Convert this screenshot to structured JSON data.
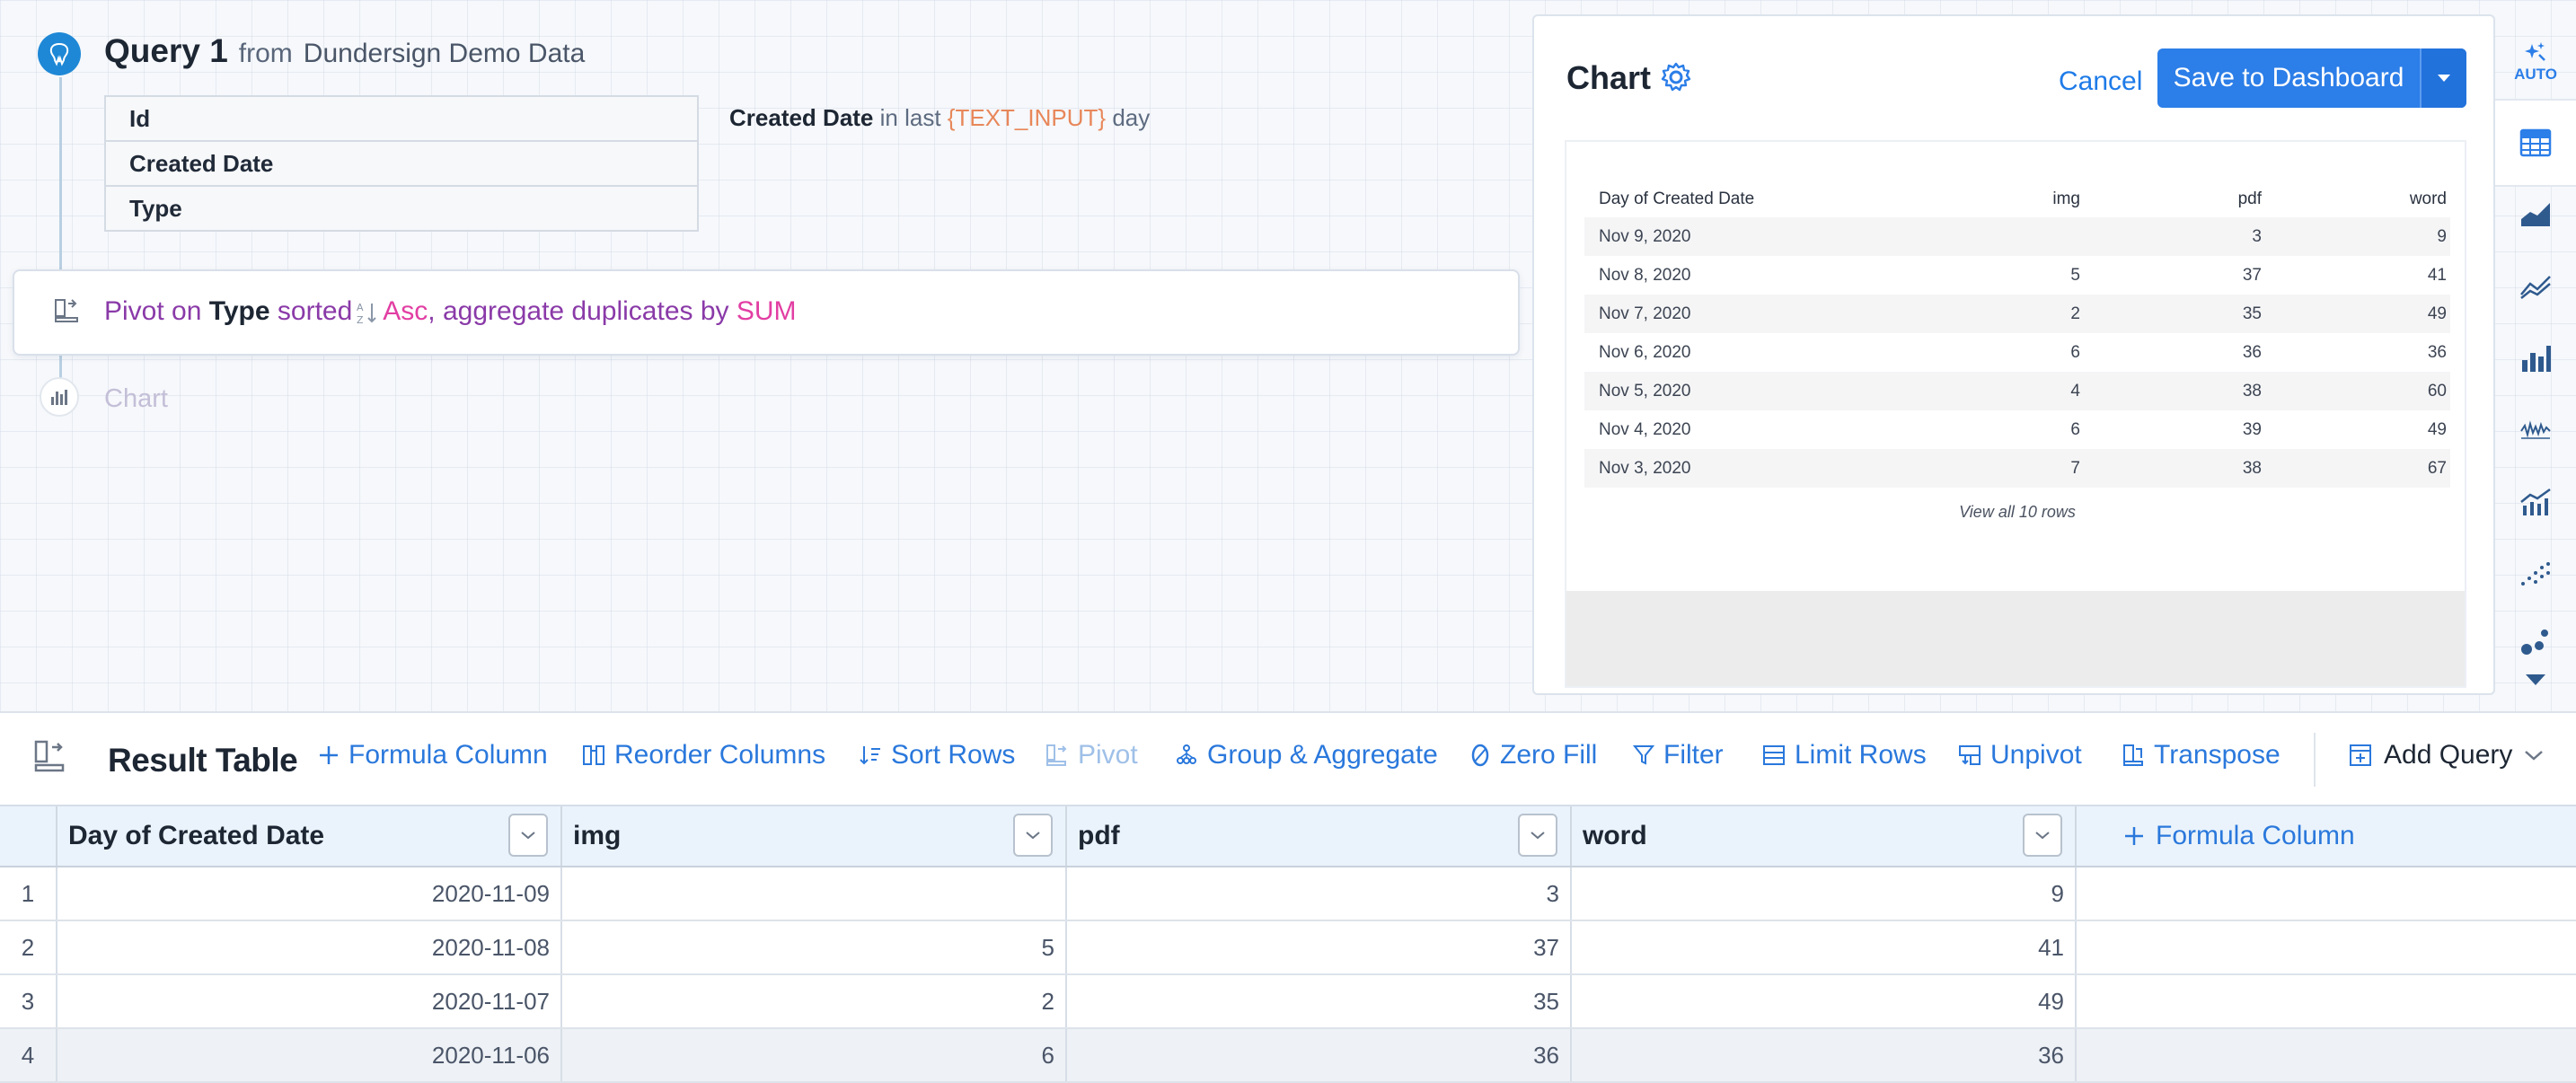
{
  "query": {
    "title": "Query 1",
    "from_label": "from",
    "source": "Dundersign Demo Data",
    "columns": [
      "Id",
      "Created Date",
      "Type"
    ],
    "filter": {
      "field": "Created Date",
      "operator": "in last",
      "variable": "{TEXT_INPUT}",
      "unit": "day"
    }
  },
  "pivot": {
    "prefix": "Pivot on",
    "field": "Type",
    "sorted_label": "sorted",
    "direction": "Asc",
    "middle": ", aggregate duplicates by",
    "aggregate": "SUM"
  },
  "chart_step": {
    "label": "Chart"
  },
  "chart_panel": {
    "title": "Chart",
    "cancel_label": "Cancel",
    "save_label": "Save to Dashboard",
    "preview": {
      "headers": [
        "Day of Created Date",
        "img",
        "pdf",
        "word"
      ],
      "rows": [
        [
          "Nov 9, 2020",
          "",
          "3",
          "9"
        ],
        [
          "Nov 8, 2020",
          "5",
          "37",
          "41"
        ],
        [
          "Nov 7, 2020",
          "2",
          "35",
          "49"
        ],
        [
          "Nov 6, 2020",
          "6",
          "36",
          "36"
        ],
        [
          "Nov 5, 2020",
          "4",
          "38",
          "60"
        ],
        [
          "Nov 4, 2020",
          "6",
          "39",
          "49"
        ],
        [
          "Nov 3, 2020",
          "7",
          "38",
          "67"
        ]
      ],
      "view_all": "View all 10 rows"
    }
  },
  "chart_types": {
    "auto_label": "AUTO"
  },
  "result_table": {
    "title": "Result Table",
    "tools": {
      "formula_column": "Formula Column",
      "reorder_columns": "Reorder Columns",
      "sort_rows": "Sort Rows",
      "pivot": "Pivot",
      "group_aggregate": "Group & Aggregate",
      "zero_fill": "Zero Fill",
      "filter": "Filter",
      "limit_rows": "Limit Rows",
      "unpivot": "Unpivot",
      "transpose": "Transpose",
      "add_query": "Add Query"
    },
    "headers": [
      "Day of Created Date",
      "img",
      "pdf",
      "word"
    ],
    "formula_column": "Formula Column",
    "rows": [
      [
        "1",
        "2020-11-09",
        "",
        "3",
        "9"
      ],
      [
        "2",
        "2020-11-08",
        "5",
        "37",
        "41"
      ],
      [
        "3",
        "2020-11-07",
        "2",
        "35",
        "49"
      ],
      [
        "4",
        "2020-11-06",
        "6",
        "36",
        "36"
      ]
    ]
  },
  "colors": {
    "accent": "#2c7ee8",
    "pivot_purple": "#8a3aa8",
    "pivot_pink": "#e23ea3",
    "variable_orange": "#e8875a"
  }
}
